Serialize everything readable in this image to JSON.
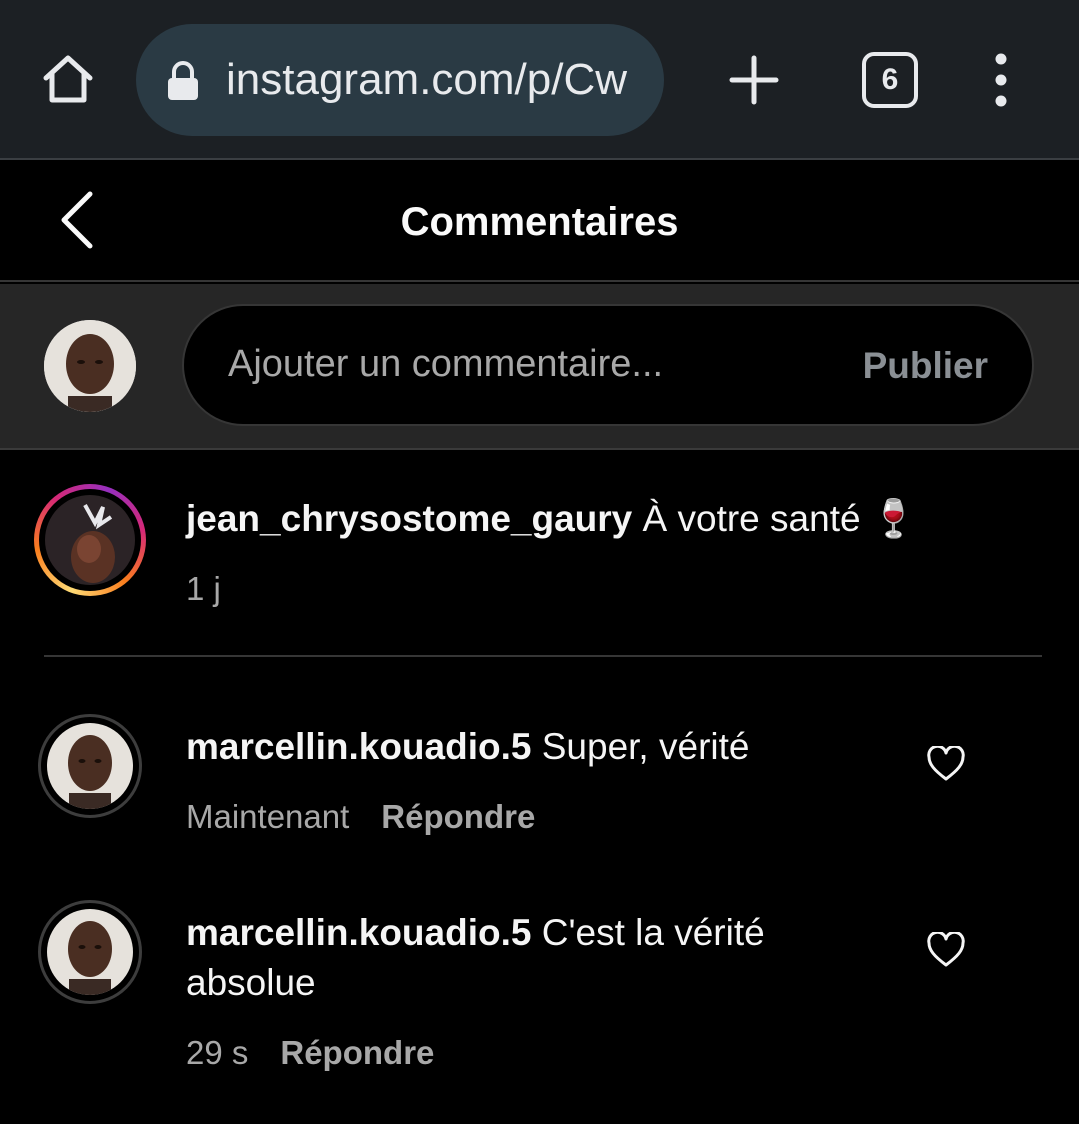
{
  "browser": {
    "url": "instagram.com/p/Cw",
    "tab_count": "6",
    "icons": {
      "home": "home-icon",
      "lock": "lock-icon",
      "new_tab": "plus-icon",
      "tabs": "tabs-icon",
      "menu": "kebab-menu-icon"
    }
  },
  "header": {
    "title": "Commentaires",
    "back_icon": "chevron-left-icon"
  },
  "compose": {
    "placeholder": "Ajouter un commentaire...",
    "publish_label": "Publier"
  },
  "caption": {
    "username": "jean_chrysostome_gaury",
    "text": "À votre santé 🍷",
    "time": "1 j"
  },
  "comments": [
    {
      "username": "marcellin.kouadio.5",
      "text": "Super, vérité",
      "time": "Maintenant",
      "reply_label": "Répondre"
    },
    {
      "username": "marcellin.kouadio.5",
      "text": "C'est la vérité absolue",
      "time": "29 s",
      "reply_label": "Répondre"
    }
  ],
  "colors": {
    "background": "#000000",
    "browser_bar": "#1c2024",
    "url_pill": "#2a3a44",
    "compose_bg": "#262626",
    "muted_text": "#a8a8a8"
  }
}
